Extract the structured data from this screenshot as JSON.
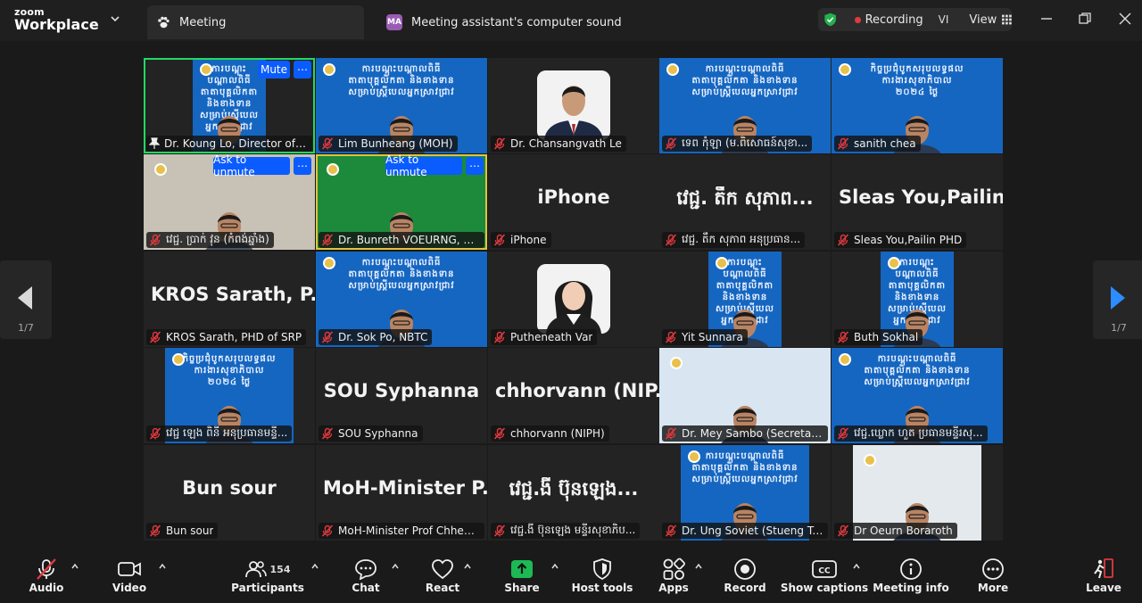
{
  "app": {
    "logo_line1": "zoom",
    "logo_line2": "Workplace",
    "tab_meeting": "Meeting",
    "tab_assistant_initials": "MA",
    "tab_assistant": "Meeting assistant's computer sound",
    "recording": "Recording",
    "language": "VI",
    "view": "View"
  },
  "colors": {
    "accent": "#0b5cff",
    "active_speaker": "#23d962",
    "recording": "#e0393e",
    "mic_muted": "#e0393e"
  },
  "tiles": [
    {
      "name": "Dr. Koung Lo, Director of Pr...",
      "btn": "Mute",
      "kind": "video"
    },
    {
      "name": "Lim Bunheang (MOH)",
      "kind": "video"
    },
    {
      "name": "Dr. Chansangvath Le",
      "kind": "photo"
    },
    {
      "name": "ទេព កុំឡា (ម.ពិសោធន៍សុខា...",
      "kind": "video"
    },
    {
      "name": "sanith chea",
      "kind": "video"
    },
    {
      "name": "វេជ្ជ. ប្រាក់ វុន (កំពង់ឆ្នាំង)",
      "btn": "Ask to unmute",
      "kind": "video"
    },
    {
      "name": "Dr. Bunreth VOEURNG, Dire...",
      "btn": "Ask to unmute",
      "kind": "video"
    },
    {
      "name": "iPhone",
      "display": "iPhone",
      "kind": "text"
    },
    {
      "name": "វេជ្ជ. តឹក សុភាព អនុប្រធាន...",
      "display": "វេជ្ជ. តឹក សុភាព...",
      "kind": "text"
    },
    {
      "name": "Sleas You,Pailin PHD",
      "display": "Sleas You,Pailin...",
      "kind": "text"
    },
    {
      "name": "KROS Sarath, PHD of SRP",
      "display": "KROS Sarath, P...",
      "kind": "text"
    },
    {
      "name": "Dr. Sok Po, NBTC",
      "kind": "video"
    },
    {
      "name": "Putheneath Var",
      "kind": "photo"
    },
    {
      "name": "Yit Sunnara",
      "kind": "video"
    },
    {
      "name": "Buth Sokhal",
      "kind": "video"
    },
    {
      "name": "វេជ្ជ ឡេង ពិនី អនុប្រធានមន្ទី...",
      "kind": "video"
    },
    {
      "name": "SOU Syphanna",
      "display": "SOU Syphanna",
      "kind": "text"
    },
    {
      "name": "chhorvann (NIPH)",
      "display": "chhorvann (NIP...",
      "kind": "text"
    },
    {
      "name": "Dr. Mey Sambo (Secretary of...",
      "kind": "video"
    },
    {
      "name": "វេជ្ជ.ឃ្លោក ហួត ប្រធានមន្ទីរសុ...",
      "kind": "video"
    },
    {
      "name": "Bun sour",
      "display": "Bun sour",
      "kind": "text"
    },
    {
      "name": "MoH-Minister Prof Chheang...",
      "display": "MoH-Minister P...",
      "kind": "text"
    },
    {
      "name": "វេជ្ជ.ងី ប៊ុនឡេង មន្ទីរសុខាភិប...",
      "display": "វេជ្ជ.ងី ប៊ុនឡេង...",
      "kind": "text"
    },
    {
      "name": "Dr. Ung Soviet (Stueng Tren...",
      "kind": "video"
    },
    {
      "name": "Dr Oeurn Boraroth",
      "kind": "video"
    }
  ],
  "video_header_lines": {
    "a": "ការបណ្តុះបណ្តាលពិធី\nតាតាបុគ្គលិកតា និងខាងទាន\nសម្រាប់ស្រ្តីបេលអ្នកស្រាវជ្រាវ",
    "b": "ការបណ្តុះបណ្តាលពិធី\nតាតាបុគ្គលិកតា និងខាងទាន\nសម្រាប់ស្រ្តីបេលអ្នកស្រាវជ្រាវ",
    "c": "កិច្ចប្រជុំបូកសរុបលទ្ធផល\nការងារសុខាភិបាល\n២០២៤ ថ្ងៃ"
  },
  "more_glyph": "⋯",
  "pager": {
    "left": "1/7",
    "right": "1/7"
  },
  "toolbar": {
    "audio": "Audio",
    "video": "Video",
    "participants": "Participants",
    "participants_count": "154",
    "chat": "Chat",
    "react": "React",
    "share": "Share",
    "host_tools": "Host tools",
    "apps": "Apps",
    "record": "Record",
    "captions": "Show captions",
    "meeting_info": "Meeting info",
    "more": "More",
    "leave": "Leave"
  }
}
